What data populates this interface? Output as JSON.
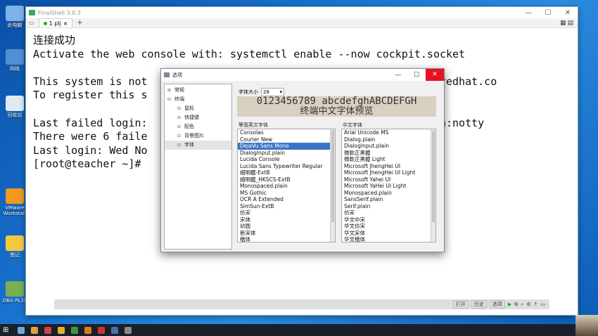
{
  "desktop": {
    "icons": [
      {
        "label": "此电脑",
        "color": "#7fb2e8"
      },
      {
        "label": "网络",
        "color": "#4f8fd6"
      },
      {
        "label": "回收站",
        "color": "#dfeaf5"
      },
      {
        "label": "VMware Workstati",
        "color": "#f09a20"
      },
      {
        "label": "笔记",
        "color": "#f5c842"
      },
      {
        "label": "DBA PL31",
        "color": "#7ab04f"
      }
    ]
  },
  "finalshell": {
    "title": "FinalShell 3.8.3",
    "tab_label": "1 plj",
    "plus": "+",
    "window_buttons": [
      "—",
      "☐",
      "✕"
    ],
    "layout_icon": "▦▤",
    "terminal_lines": [
      "连接成功",
      "Activate the web console with: systemctl enable --now cockpit.socket",
      "",
      "This system is not                                   ps://cloud.redhat.co",
      "To register this s",
      "",
      "Last failed login:                                   10.28 on ssh:notty",
      "There were 6 faile                                   ul login.",
      "Last login: Wed No",
      "[root@teacher ~]# "
    ],
    "bottom_bar": {
      "pill1": "打开",
      "pill2": "历史",
      "pill3": "选项"
    }
  },
  "dialog": {
    "title": "选项",
    "window_buttons": [
      "—",
      "☐",
      "✕"
    ],
    "tree": [
      {
        "label": "常规",
        "level": 1,
        "toggle": "⊞"
      },
      {
        "label": "终端",
        "level": 1,
        "toggle": "⊟"
      },
      {
        "label": "鼠标",
        "level": 2,
        "toggle": "⊟"
      },
      {
        "label": "快捷键",
        "level": 2,
        "toggle": "⊟"
      },
      {
        "label": "配色",
        "level": 2,
        "toggle": "⊟"
      },
      {
        "label": "背景图片",
        "level": 2,
        "toggle": "⊟"
      },
      {
        "label": "字体",
        "level": 2,
        "toggle": "⊟",
        "selected": true
      }
    ],
    "font_size_label": "字体大小",
    "font_size_value": "28",
    "preview_line1": "0123456789 abcdefghABCDEFGH",
    "preview_line2": "终端中文字体预览",
    "mono_label": "等宽英文字体",
    "cn_label": "中文字体",
    "mono_fonts": [
      "Consolas",
      "Courier New",
      "DejaVu Sans Mono",
      "DialogInput.plain",
      "Lucida Console",
      "Lucida Sans Typewriter Regular",
      "細明體-ExtB",
      "細明體_HKSCS-ExtB",
      "Monospaced.plain",
      "MS Gothic",
      "OCR A Extended",
      "SimSun-ExtB",
      "仿宋",
      "宋体",
      "幼圆",
      "新宋体",
      "楷体"
    ],
    "mono_selected": 2,
    "cn_fonts": [
      "Arial Unicode MS",
      "Dialog.plain",
      "DialogInput.plain",
      "微軟正黑體",
      "微軟正黑體 Light",
      "Microsoft JhengHei UI",
      "Microsoft JhengHei UI Light",
      "Microsoft Yahei UI",
      "Microsoft YaHei UI Light",
      "Monospaced.plain",
      "SansSerif.plain",
      "Serif.plain",
      "仿宋",
      "华文中宋",
      "华文仿宋",
      "华文宋体",
      "华文楷体"
    ]
  }
}
